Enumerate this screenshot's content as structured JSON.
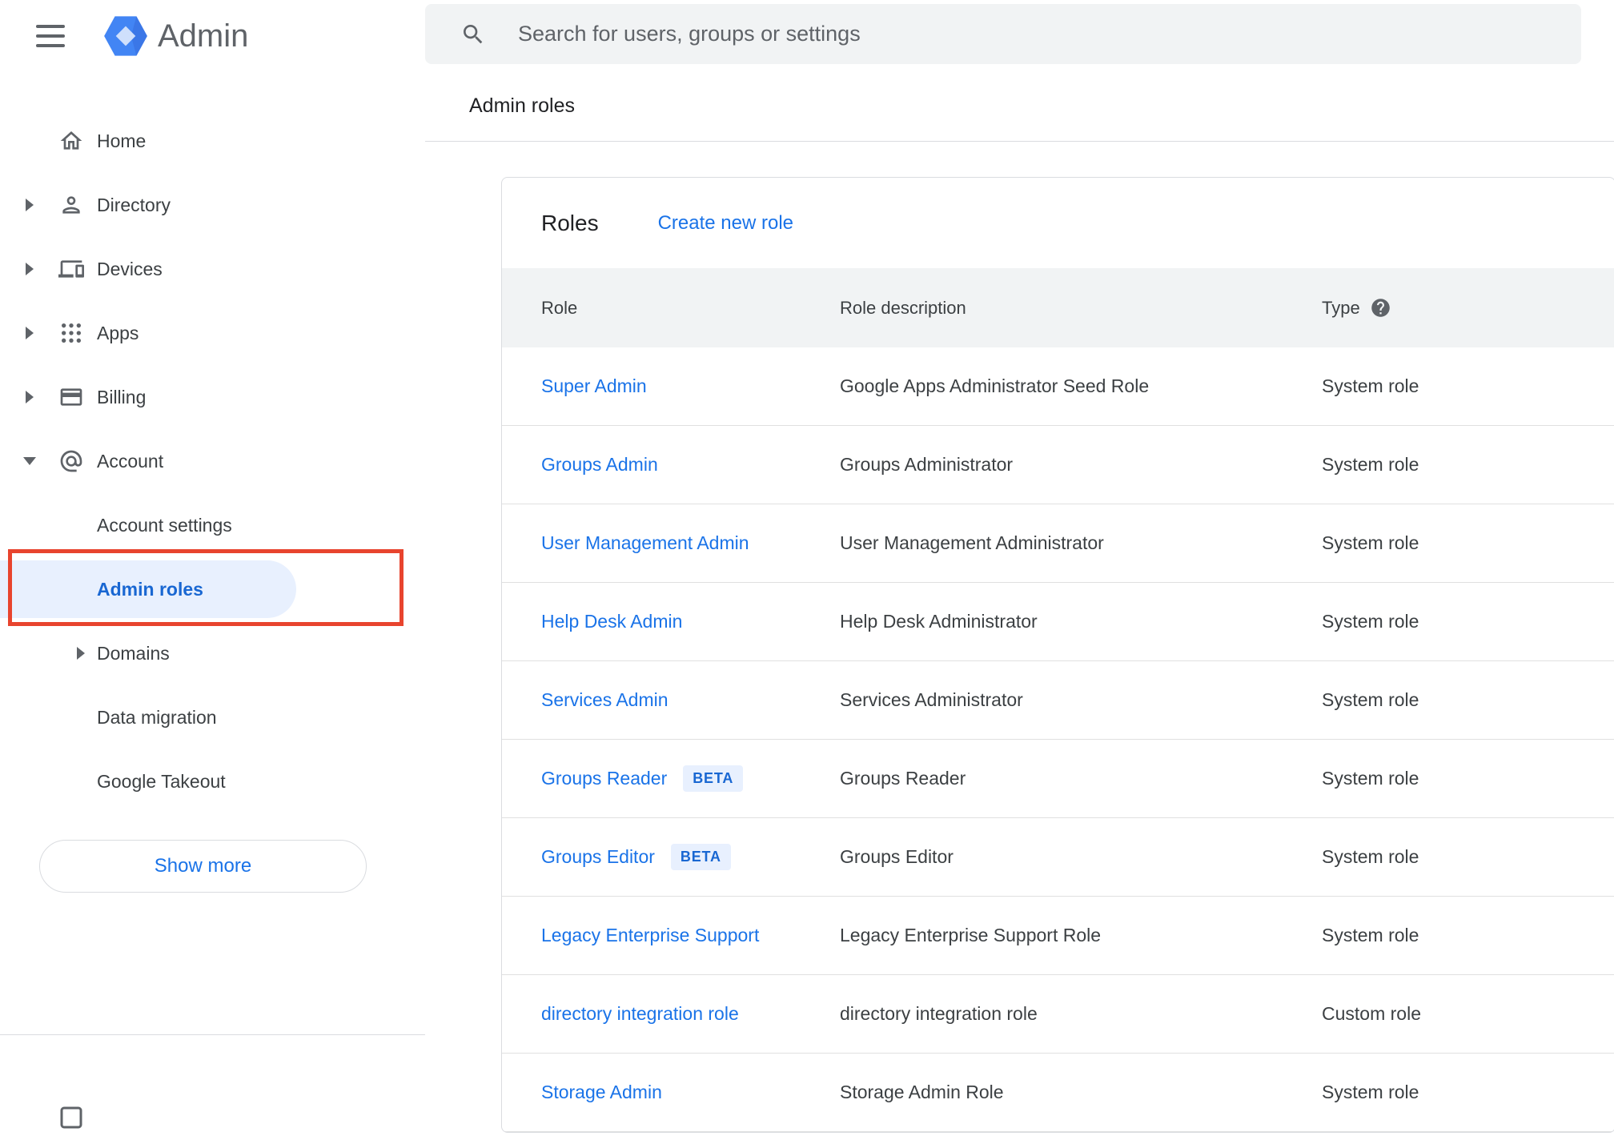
{
  "topbar": {
    "app_name": "Admin",
    "search_placeholder": "Search for users, groups or settings",
    "menu_icon": "hamburger-icon",
    "logo_icon": "admin-hexagon-logo",
    "search_icon": "search-icon"
  },
  "breadcrumb": "Admin roles",
  "sidebar": {
    "items": [
      {
        "label": "Home",
        "icon": "home-icon",
        "expandable": false,
        "expanded": false
      },
      {
        "label": "Directory",
        "icon": "person-icon",
        "expandable": true,
        "expanded": false
      },
      {
        "label": "Devices",
        "icon": "devices-icon",
        "expandable": true,
        "expanded": false
      },
      {
        "label": "Apps",
        "icon": "apps-grid-icon",
        "expandable": true,
        "expanded": false
      },
      {
        "label": "Billing",
        "icon": "credit-card-icon",
        "expandable": true,
        "expanded": false
      },
      {
        "label": "Account",
        "icon": "at-sign-icon",
        "expandable": true,
        "expanded": true
      }
    ],
    "account_children": [
      {
        "label": "Account settings",
        "expandable": false,
        "selected": false
      },
      {
        "label": "Admin roles",
        "expandable": false,
        "selected": true,
        "annotated": true
      },
      {
        "label": "Domains",
        "expandable": true,
        "selected": false
      },
      {
        "label": "Data migration",
        "expandable": false,
        "selected": false
      },
      {
        "label": "Google Takeout",
        "expandable": false,
        "selected": false
      }
    ],
    "show_more_label": "Show more"
  },
  "main": {
    "card": {
      "title": "Roles",
      "create_link_label": "Create new role",
      "table": {
        "columns": [
          "Role",
          "Role description",
          "Type"
        ],
        "type_help_icon": "help-icon",
        "beta_badge_label": "BETA",
        "rows": [
          {
            "role": "Super Admin",
            "beta": false,
            "description": "Google Apps Administrator Seed Role",
            "type": "System role"
          },
          {
            "role": "Groups Admin",
            "beta": false,
            "description": "Groups Administrator",
            "type": "System role"
          },
          {
            "role": "User Management Admin",
            "beta": false,
            "description": "User Management Administrator",
            "type": "System role"
          },
          {
            "role": "Help Desk Admin",
            "beta": false,
            "description": "Help Desk Administrator",
            "type": "System role"
          },
          {
            "role": "Services Admin",
            "beta": false,
            "description": "Services Administrator",
            "type": "System role"
          },
          {
            "role": "Groups Reader",
            "beta": true,
            "description": "Groups Reader",
            "type": "System role"
          },
          {
            "role": "Groups Editor",
            "beta": true,
            "description": "Groups Editor",
            "type": "System role"
          },
          {
            "role": "Legacy Enterprise Support",
            "beta": false,
            "description": "Legacy Enterprise Support Role",
            "type": "System role"
          },
          {
            "role": "directory integration role",
            "beta": false,
            "description": "directory integration role",
            "type": "Custom role"
          },
          {
            "role": "Storage Admin",
            "beta": false,
            "description": "Storage Admin Role",
            "type": "System role"
          }
        ]
      }
    }
  },
  "annotation": {
    "color": "#e8442e",
    "target": "Admin roles"
  },
  "colors": {
    "link_blue": "#1a73e8",
    "selected_blue": "#1967d2",
    "selected_pill_bg": "#e8f0fe",
    "beta_badge_bg": "#e8f0fe",
    "beta_badge_text": "#1967d2",
    "table_header_bg": "#f1f3f4",
    "search_bg": "#f1f3f4",
    "divider": "#e0e0e0",
    "text_primary": "#202124",
    "text_secondary": "#5f6368"
  }
}
